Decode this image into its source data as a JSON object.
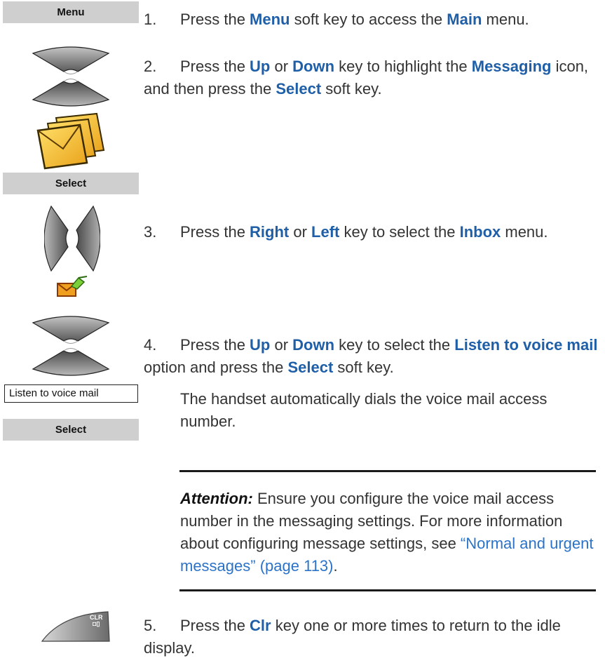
{
  "softkeys": {
    "menu": "Menu",
    "select1": "Select",
    "select2": "Select"
  },
  "listbox": "Listen to voice mail",
  "steps": [
    {
      "num": "1.",
      "parts": [
        {
          "t": "Press the "
        },
        {
          "t": "Menu",
          "k": 1
        },
        {
          "t": " soft key to access the "
        },
        {
          "t": "Main",
          "k": 1
        },
        {
          "t": " menu."
        }
      ]
    },
    {
      "num": "2.",
      "parts": [
        {
          "t": "Press the "
        },
        {
          "t": "Up",
          "k": 1
        },
        {
          "t": " or "
        },
        {
          "t": "Down",
          "k": 1
        },
        {
          "t": " key to highlight the "
        },
        {
          "t": "Messaging",
          "k": 1
        },
        {
          "t": " icon, and then press the "
        },
        {
          "t": "Select",
          "k": 1
        },
        {
          "t": " soft key."
        }
      ]
    },
    {
      "num": "3.",
      "parts": [
        {
          "t": "Press the "
        },
        {
          "t": "Right",
          "k": 1
        },
        {
          "t": " or "
        },
        {
          "t": "Left",
          "k": 1
        },
        {
          "t": " key to select the "
        },
        {
          "t": "Inbox",
          "k": 1
        },
        {
          "t": " menu."
        }
      ]
    },
    {
      "num": "4.",
      "parts": [
        {
          "t": "Press the "
        },
        {
          "t": "Up",
          "k": 1
        },
        {
          "t": " or "
        },
        {
          "t": "Down",
          "k": 1
        },
        {
          "t": " key to select the "
        },
        {
          "t": "Listen to voice mail",
          "k": 1
        },
        {
          "t": " option and press the "
        },
        {
          "t": "Select",
          "k": 1
        },
        {
          "t": " soft key."
        }
      ]
    },
    {
      "num": "5.",
      "parts": [
        {
          "t": "Press the "
        },
        {
          "t": "Clr",
          "k": 1
        },
        {
          "t": " key one or more times to return to the idle display."
        }
      ]
    }
  ],
  "note_after_step4": "The handset automatically dials the voice mail access number.",
  "attention": {
    "label": "Attention:",
    "text": " Ensure you configure the voice mail access number in the messaging settings. For more information about configuring message settings, see ",
    "link": "“Normal and urgent messages” (page 113)",
    "end": "."
  },
  "clr_key": {
    "top": "CLR",
    "bottom": "◘▯"
  }
}
